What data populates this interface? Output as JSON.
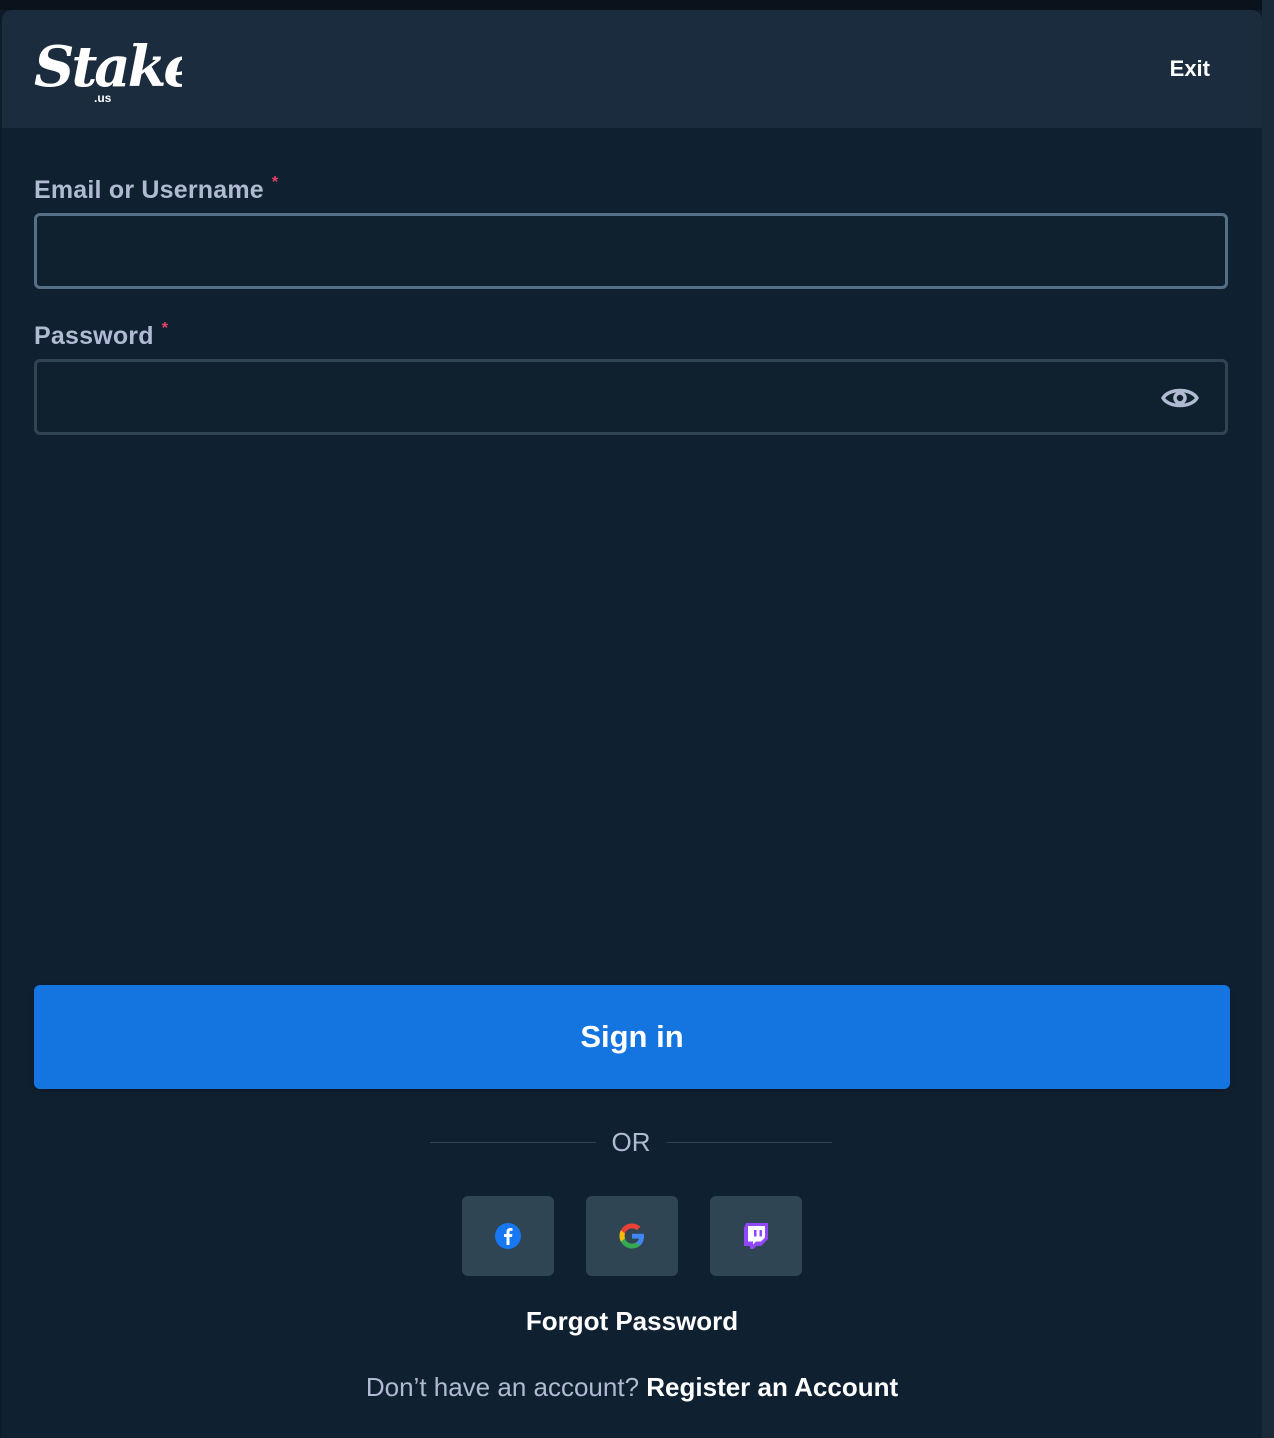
{
  "header": {
    "logo_text": "Stake",
    "logo_suffix": ".us",
    "exit_label": "Exit"
  },
  "form": {
    "email": {
      "label": "Email or Username",
      "required_mark": "*",
      "value": "",
      "placeholder": ""
    },
    "password": {
      "label": "Password",
      "required_mark": "*",
      "value": "",
      "placeholder": ""
    },
    "submit_label": "Sign in"
  },
  "divider": {
    "text": "OR"
  },
  "social": [
    {
      "name": "facebook",
      "icon": "facebook-icon",
      "color": "#1877f2"
    },
    {
      "name": "google",
      "icon": "google-icon"
    },
    {
      "name": "twitch",
      "icon": "twitch-icon",
      "color": "#9146ff"
    }
  ],
  "links": {
    "forgot_password": "Forgot Password",
    "register_prompt": "Don’t have an account?",
    "register_link": "Register an Account"
  },
  "colors": {
    "primary": "#1475e1",
    "background": "#0f2131",
    "header": "#1a2c3d",
    "required": "#ed4163",
    "label": "#b1bad3"
  }
}
